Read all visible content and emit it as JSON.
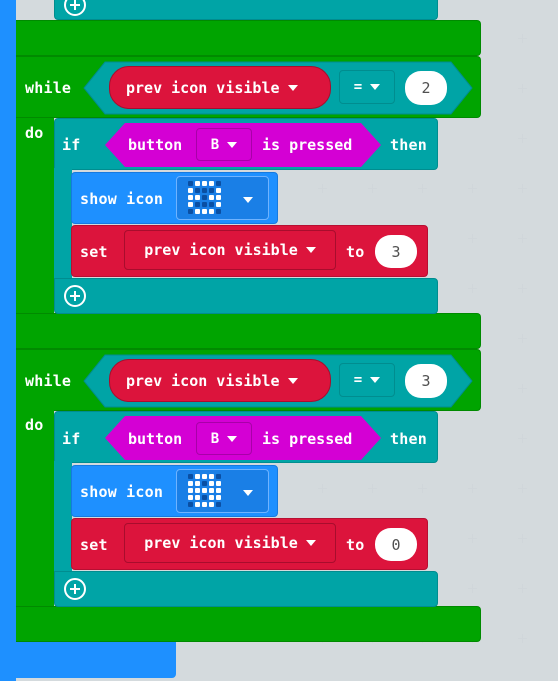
{
  "colors": {
    "loops": "#00a400",
    "logic": "#00a4a6",
    "basic": "#1e90ff",
    "variables": "#dc143c",
    "input": "#d400d4",
    "canvas": "#ecf0f1"
  },
  "loop1": {
    "while_label": "while",
    "do_label": "do",
    "variable": "prev icon visible",
    "operator": "=",
    "compare_value": "2",
    "if_label": "if",
    "button_label": "button",
    "button_choice": "B",
    "pressed_label": "is pressed",
    "then_label": "then",
    "show_icon_label": "show icon",
    "set_label": "set",
    "set_variable": "prev icon visible",
    "to_label": "to",
    "set_value": "3"
  },
  "loop2": {
    "while_label": "while",
    "do_label": "do",
    "variable": "prev icon visible",
    "operator": "=",
    "compare_value": "3",
    "if_label": "if",
    "button_label": "button",
    "button_choice": "B",
    "pressed_label": "is pressed",
    "then_label": "then",
    "show_icon_label": "show icon",
    "set_label": "set",
    "set_variable": "prev icon visible",
    "to_label": "to",
    "set_value": "0"
  },
  "icons": {
    "icon1": "led-pattern-icon",
    "icon2": "led-pattern-icon"
  }
}
